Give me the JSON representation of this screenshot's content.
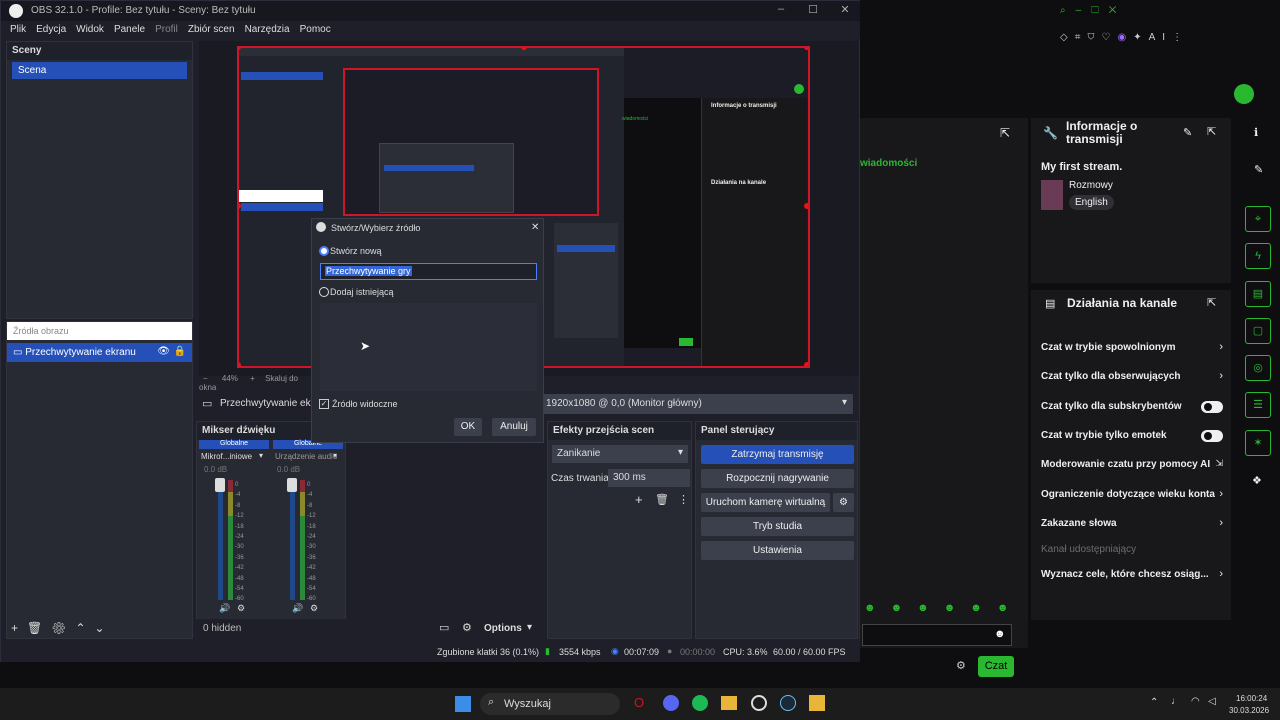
{
  "obs": {
    "window_title": "OBS 32.1.0 - Profile: Bez tytułu - Sceny: Bez tytułu",
    "menu": [
      "Plik",
      "Edycja",
      "Widok",
      "Panele",
      "Profil",
      "Zbiór scen",
      "Narzędzia",
      "Pomoc"
    ],
    "scenes": {
      "header": "Sceny",
      "items": [
        "Scena"
      ]
    },
    "sources": {
      "placeholder": "Źródła obrazu",
      "items": [
        "Przechwytywanie ekranu"
      ]
    },
    "preview_footer": {
      "zoom": "44%",
      "plus": "+",
      "scale": "Skaluj do okna"
    },
    "source_bar": {
      "name": "Przechwytywanie ekranu",
      "display": "1920x1080 @ 0,0 (Monitor główny)"
    },
    "mixer": {
      "header": "Mikser dźwięku",
      "tabs": [
        "Globalne",
        "Globalne"
      ],
      "channels": [
        {
          "name": "Mikrof...iniowe",
          "db": "0.0 dB"
        },
        {
          "name": "Urządzenie audio",
          "db": "0.0 dB"
        }
      ],
      "scale": [
        "0",
        "-4",
        "-8",
        "-12",
        "-18",
        "-24",
        "-30",
        "-36",
        "-42",
        "-48",
        "-54",
        "-60"
      ],
      "hidden": "0 hidden",
      "options": "Options"
    },
    "transitions": {
      "header": "Efekty przejścia scen",
      "type": "Zanikanie",
      "duration_label": "Czas trwania",
      "duration": "300 ms"
    },
    "controls": {
      "header": "Panel sterujący",
      "buttons": [
        "Zatrzymaj transmisję",
        "Rozpocznij nagrywanie",
        "Uruchom kamerę wirtualną",
        "Tryb studia",
        "Ustawienia"
      ]
    },
    "status": {
      "dropped": "Zgubione klatki 36 (0.1%)",
      "kbps": "3554 kbps",
      "live": "00:07:09",
      "rec": "00:00:00",
      "cpu": "CPU: 3.6%",
      "fps": "60.00 / 60.00 FPS"
    },
    "dialog": {
      "title": "Stwórz/Wybierz źródło",
      "create_new": "Stwórz nową",
      "name_value": "Przechwytywanie gry",
      "add_existing": "Dodaj istniejącą",
      "visible": "Źródło widoczne",
      "ok": "OK",
      "cancel": "Anuluj"
    }
  },
  "twitch": {
    "info_title": "Informacje o transmisji",
    "stream_title": "My first stream.",
    "category": "Rozmowy",
    "language": "English",
    "chat_partial": "wiadomości",
    "actions_title": "Działania na kanale",
    "actions": [
      {
        "label": "Czat w trybie spowolnionym",
        "kind": "arrow"
      },
      {
        "label": "Czat tylko dla obserwujących",
        "kind": "arrow"
      },
      {
        "label": "Czat tylko dla subskrybentów",
        "kind": "toggle"
      },
      {
        "label": "Czat w trybie tylko emotek",
        "kind": "toggle"
      },
      {
        "label": "Moderowanie czatu przy pomocy AI",
        "kind": "ext"
      },
      {
        "label": "Ograniczenie dotyczące wieku konta",
        "kind": "arrow"
      },
      {
        "label": "Zakazane słowa",
        "kind": "arrow"
      },
      {
        "label": "Kanał udostępniający",
        "kind": "disabled"
      },
      {
        "label": "Wyznacz cele, które chcesz osiąg...",
        "kind": "arrow"
      }
    ],
    "chat_button": "Czat",
    "ai_label": "AI"
  },
  "taskbar": {
    "search": "Wyszukaj",
    "time": "16:00:24",
    "date": "30.03.2026"
  },
  "colors": {
    "accent_blue": "#2550b8",
    "twitch_green": "#2ab830",
    "red_border": "#d0142a"
  }
}
